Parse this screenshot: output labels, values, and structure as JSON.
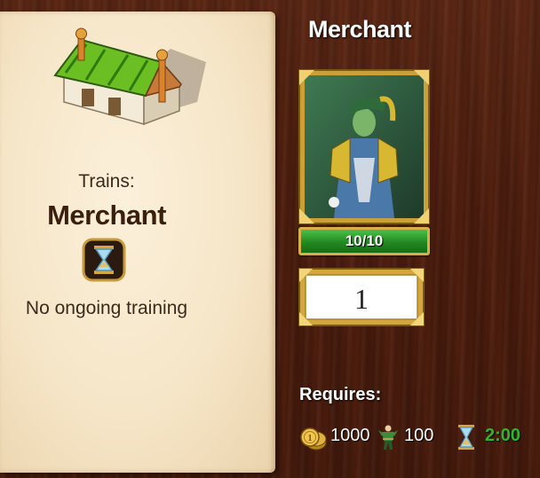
{
  "left": {
    "trains_label": "Trains:",
    "unit_name": "Merchant",
    "status": "No ongoing training"
  },
  "right": {
    "title": "Merchant",
    "count": "10/10",
    "count_fraction": 1.0,
    "quantity": "1",
    "requires_label": "Requires:",
    "requirements": {
      "gold": "1000",
      "population": "100",
      "time": "2:00"
    }
  },
  "icons": {
    "building": "merchant-building-icon",
    "hourglass": "hourglass-icon",
    "gold": "gold-coins-icon",
    "population": "population-icon",
    "time": "hourglass-icon"
  },
  "colors": {
    "time_text": "#2fb52a",
    "count_bar": "#1d7a1d",
    "frame_gold": "#d8b048",
    "panel_cream": "#f6e6c8",
    "wood": "#4a1d0e"
  }
}
